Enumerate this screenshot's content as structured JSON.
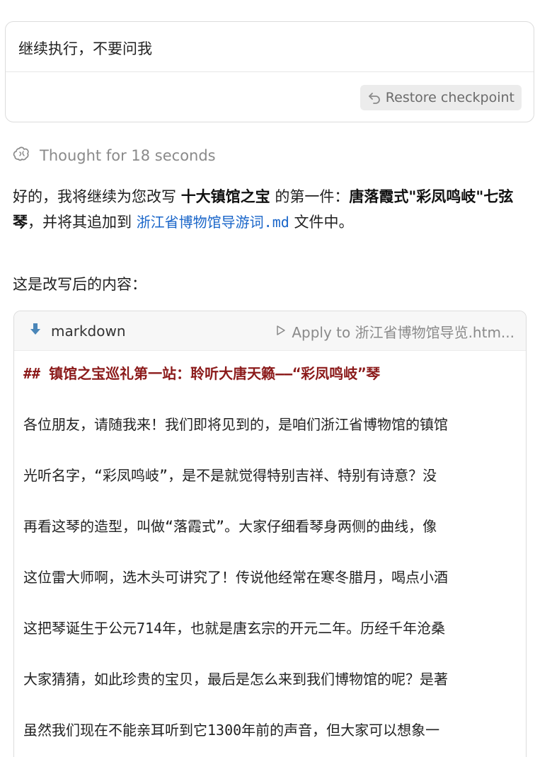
{
  "user_message": {
    "text": "继续执行，不要问我",
    "restore_label": "Restore checkpoint"
  },
  "thought": {
    "label": "Thought for 18 seconds"
  },
  "assistant": {
    "p1_a": "好的，我将继续为您改写 ",
    "p1_b": "十大镇馆之宝",
    "p1_c": " 的第一件：",
    "p1_d": "唐落霞式\"彩凤鸣岐\"七弦琴",
    "p1_e": "，并将其追加到 ",
    "file_link": "浙江省博物馆导游词.md",
    "p1_f": " 文件中。",
    "p2": "这是改写后的内容："
  },
  "code_block": {
    "language": "markdown",
    "apply_label": "Apply to 浙江省博物馆导览.htm...",
    "lines": [
      "## 镇馆之宝巡礼第一站：聆听大唐天籁——“彩凤鸣岐”琴",
      "各位朋友，请随我来！我们即将见到的，是咱们浙江省博物馆的镇馆",
      "光听名字，“彩凤鸣岐”，是不是就觉得特别吉祥、特别有诗意？没",
      "再看这琴的造型，叫做“落霞式”。大家仔细看琴身两侧的曲线，像",
      "这位雷大师啊，选木头可讲究了！传说他经常在寒冬腊月，喝点小酒",
      "这把琴诞生于公元714年，也就是唐玄宗的开元二年。历经千年沧桑",
      "大家猜猜，如此珍贵的宝贝，最后是怎么来到我们博物馆的呢？是著",
      "虽然我们现在不能亲耳听到它1300年前的声音，但大家可以想象一"
    ]
  },
  "colors": {
    "link": "#1a66c9",
    "heading": "#8b1a1a",
    "muted": "#8a8a8a"
  }
}
